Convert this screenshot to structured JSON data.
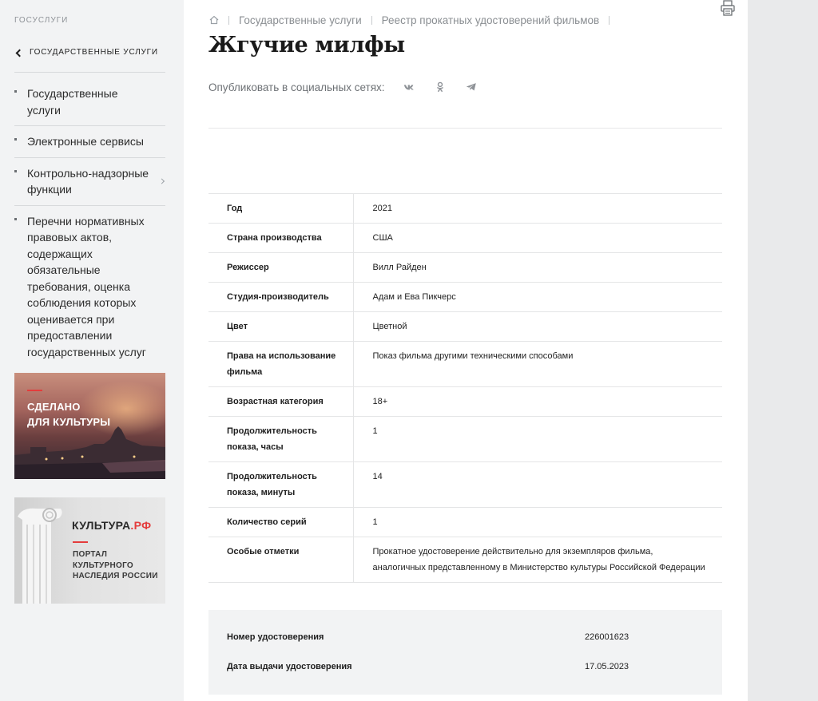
{
  "sidebar": {
    "site_label": "ГОСУСЛУГИ",
    "back_label": "ГОСУДАРСТВЕННЫЕ УСЛУГИ",
    "items": [
      {
        "label": "Государственные услуги"
      },
      {
        "label": "Электронные сервисы"
      },
      {
        "label": "Контрольно-надзорные функции"
      },
      {
        "label": "Перечни нормативных правовых актов, содержащих обязательные требования, оценка соблюдения которых оценивается при предоставлении государственных услуг"
      }
    ],
    "banner_culture": {
      "line1": "СДЕЛАНО",
      "line2": "ДЛЯ КУЛЬТУРЫ"
    },
    "banner_portal": {
      "brand": "КУЛЬТУРА",
      "brand_suffix": ".РФ",
      "line1": "ПОРТАЛ",
      "line2": "КУЛЬТУРНОГО",
      "line3": "НАСЛЕДИЯ РОССИИ"
    }
  },
  "breadcrumb": {
    "items": [
      {
        "label": "Государственные услуги"
      },
      {
        "label": "Реестр прокатных удостоверений фильмов"
      }
    ]
  },
  "page": {
    "title": "Жгучие милфы",
    "share_label": "Опубликовать в социальных сетях:"
  },
  "details": [
    {
      "key": "Год",
      "value": "2021"
    },
    {
      "key": "Страна производства",
      "value": "США"
    },
    {
      "key": "Режиссер",
      "value": "Вилл Райден"
    },
    {
      "key": "Студия-производитель",
      "value": "Адам и Ева Пикчерс"
    },
    {
      "key": "Цвет",
      "value": "Цветной"
    },
    {
      "key": "Права на использование фильма",
      "value": "Показ фильма другими техническими способами"
    },
    {
      "key": "Возрастная категория",
      "value": "18+"
    },
    {
      "key": "Продолжительность показа, часы",
      "value": "1"
    },
    {
      "key": "Продолжительность показа, минуты",
      "value": "14"
    },
    {
      "key": "Количество серий",
      "value": "1"
    },
    {
      "key": "Особые отметки",
      "value": "Прокатное удостоверение действительно для экземпляров фильма, аналогичных представленному в Министерство культуры Российской Федерации"
    }
  ],
  "certificate": {
    "number_label": "Номер удостоверения",
    "number_value": "226001623",
    "date_label": "Дата выдачи удостоверения",
    "date_value": "17.05.2023"
  },
  "icons": {
    "home": "home-icon",
    "print": "printer-icon",
    "vk": "vk-icon",
    "ok": "odnoklassniki-icon",
    "telegram": "telegram-icon"
  },
  "colors": {
    "accent_red": "#e43c3c",
    "sidebar_bg": "#f2f3f4",
    "text_muted": "#8a8e92"
  }
}
